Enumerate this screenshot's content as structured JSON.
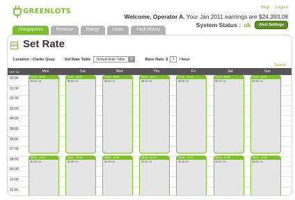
{
  "brand": {
    "name": "GREENLOTS",
    "color": "#7bbf2a"
  },
  "top_links": {
    "help": "Help",
    "logout": "Logout"
  },
  "welcome": {
    "prefix": "Welcome, Operator A.",
    "earnings": "Your Jan 2011 earnings are $24,393.08"
  },
  "status": {
    "label": "System Status :",
    "value": "ok",
    "alert_button": "Alert Settings"
  },
  "tabs": [
    {
      "label": "Chargepoints",
      "active": true
    },
    {
      "label": "Revenue",
      "active": false
    },
    {
      "label": "Energy",
      "active": false
    },
    {
      "label": "Users",
      "active": false
    },
    {
      "label": "Fault History",
      "active": false
    }
  ],
  "page": {
    "back_icon": "double-chevron-left-icon",
    "back_glyph": "<<",
    "title": "Set Rate",
    "location_label": "Location : Clarke Quay",
    "rate_table_label": "Set Rate Table",
    "rate_table_value": "Default Rate Table",
    "base_rate_label": "Base Rate: $",
    "base_rate_value": "1",
    "base_rate_unit": "/ hour",
    "save_label": "Save to"
  },
  "calendar": {
    "gmt_label": "GMT +08",
    "days": [
      "Mon",
      "Tue",
      "Wed",
      "Thu",
      "Fri",
      "Sat",
      "Sun"
    ],
    "hours": [
      "00:00",
      "01:00",
      "02:00",
      "03:00",
      "04:00",
      "05:00",
      "06:00",
      "07:00",
      "08:00",
      "09:00",
      "10:00",
      "11:00"
    ],
    "blocks": [
      {
        "time": "00:00 - 08:00",
        "rates": [
          "$0.00 / hr",
          "$0.00 / hr",
          "$0.00 / hr",
          "$0.00 / hr",
          "$0.00 / hr",
          "$1.20 / hr",
          "$0.00 / hr"
        ]
      },
      {
        "time": "08:00 - 12:00",
        "rates": [
          "$1.00 / hr",
          "$1.30 / hr",
          "$1.20 / hr",
          "$1.30 / hr",
          "$1.30 / hr",
          "$1.00 / hr",
          "$0.00 / hr"
        ]
      }
    ]
  }
}
